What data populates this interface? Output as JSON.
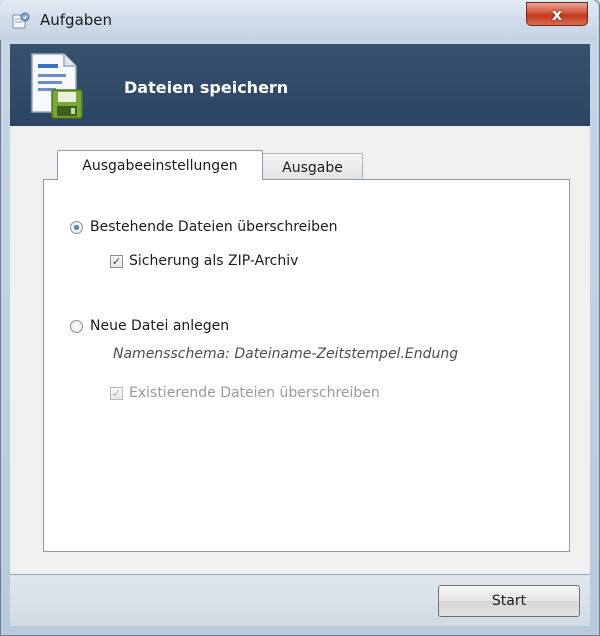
{
  "window": {
    "title": "Aufgaben",
    "close_label": "x"
  },
  "banner": {
    "title": "Dateien speichern",
    "icon": "save-file-icon"
  },
  "tabs": [
    {
      "label": "Ausgabeeinstellungen",
      "active": true
    },
    {
      "label": "Ausgabe",
      "active": false
    }
  ],
  "options": {
    "overwrite": {
      "label": "Bestehende Dateien überschreiben",
      "selected": true
    },
    "zip_backup": {
      "label": "Sicherung als ZIP-Archiv",
      "checked": true,
      "enabled": true
    },
    "new_file": {
      "label": "Neue Datei anlegen",
      "selected": false
    },
    "naming_scheme": "Namensschema: Dateiname-Zeitstempel.Endung",
    "overwrite_existing": {
      "label": "Existierende Dateien überschreiben",
      "checked": true,
      "enabled": false
    }
  },
  "footer": {
    "start_label": "Start"
  },
  "colors": {
    "banner": "#2d4562",
    "close_button": "#c23a1d",
    "radio_fill": "#1b4f9e"
  }
}
